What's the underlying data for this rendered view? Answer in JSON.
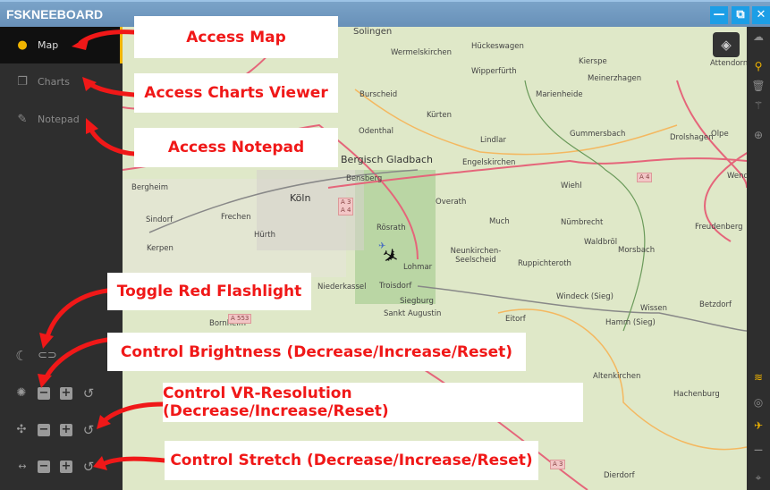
{
  "window": {
    "title": "FSKNEEBOARD",
    "buttons": {
      "minimize": "—",
      "popout": "⧉",
      "close": "✕"
    }
  },
  "sidebar": {
    "items": [
      {
        "label": "Map",
        "icon": "globe-icon",
        "active": true
      },
      {
        "label": "Charts",
        "icon": "copy-icon"
      },
      {
        "label": "Notepad",
        "icon": "edit-icon"
      }
    ]
  },
  "controls": {
    "flashlight": {
      "icon": "moon-icon",
      "toggle": "toggle-icon"
    },
    "brightness": {
      "icon": "sun-icon",
      "decrease": "−",
      "increase": "+",
      "reset": "↺"
    },
    "vr_resolution": {
      "icon": "expand-icon",
      "decrease": "−",
      "increase": "+",
      "reset": "↺"
    },
    "stretch": {
      "icon": "arrows-horizontal-icon",
      "decrease": "−",
      "increase": "+",
      "reset": "↺"
    }
  },
  "map": {
    "places": [
      "Solingen",
      "Hückeswagen",
      "Wermelskirchen",
      "Wipperfürth",
      "Kierspe",
      "Meinerzhagen",
      "Attendorn",
      "Burscheid",
      "Marienheide",
      "Kürten",
      "Odenthal",
      "Gummersbach",
      "Drolshagen",
      "Olpe",
      "Lindlar",
      "Bergisch Gladbach",
      "Engelskirchen",
      "Bensberg",
      "Bergheim",
      "Köln",
      "Overath",
      "Wenden",
      "Much",
      "Nümbrecht",
      "Sindorf",
      "Frechen",
      "Rösrath",
      "Hürth",
      "Waldbröl",
      "Morsbach",
      "Freudenberg",
      "Kerpen",
      "Neunkirchen-Seelscheid",
      "Ruppichteroth",
      "Lohmar",
      "Niederkassel",
      "Troisdorf",
      "Siegburg",
      "Sankt Augustin",
      "Bornheim",
      "Windeck (Sieg)",
      "Wissen",
      "Betzdorf",
      "Eitorf",
      "Hamm (Sieg)",
      "Altenkirchen",
      "Hachenburg",
      "Dierdorf",
      "Wiehl"
    ],
    "shields": [
      "A 3\nA 4",
      "A 553",
      "A 4",
      "A 3"
    ]
  },
  "toolbar": {
    "icons": [
      "cloud-download-icon",
      "map-marker-icon",
      "trash-icon",
      "magic-wand-icon",
      "zoom-icon",
      "wind-icon",
      "eye-slash-icon",
      "plane-icon",
      "helicopter-icon",
      "crosshair-icon"
    ]
  },
  "callouts": [
    "Access Map",
    "Access Charts Viewer",
    "Access Notepad",
    "Toggle Red Flashlight",
    "Control Brightness (Decrease/Increase/Reset)",
    "Control VR-Resolution (Decrease/Increase/Reset)",
    "Control Stretch (Decrease/Increase/Reset)"
  ],
  "colors": {
    "accent": "#f0b400",
    "titlebar": "#6f98c0",
    "window_button": "#1c9ee6",
    "callout_text": "#f01818",
    "arrow": "#f01818"
  }
}
